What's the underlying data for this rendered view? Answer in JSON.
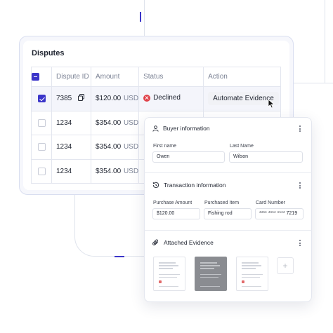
{
  "disputes": {
    "title": "Disputes",
    "columns": [
      "Dispute ID",
      "Amount",
      "Status",
      "Action"
    ],
    "rows": [
      {
        "id": "7385",
        "amount": "$120.00",
        "currency": "USD",
        "status": "Declined",
        "action": "Automate Evidence",
        "selected": true
      },
      {
        "id": "1234",
        "amount": "$354.00",
        "currency": "USD",
        "selected": false
      },
      {
        "id": "1234",
        "amount": "$354.00",
        "currency": "USD",
        "selected": false
      },
      {
        "id": "1234",
        "amount": "$354.00",
        "currency": "USD",
        "selected": false
      }
    ]
  },
  "evidence_card": {
    "buyer": {
      "title": "Buyer information",
      "first_name_label": "First name",
      "first_name_value": "Owen",
      "last_name_label": "Last Name",
      "last_name_value": "Wilson"
    },
    "transaction": {
      "title": "Transaction information",
      "amount_label": "Purchase Amount",
      "amount_value": "$120.00",
      "item_label": "Purchased Item",
      "item_value": "Fishing rod",
      "card_label": "Card Number",
      "card_value": "**** **** **** 7219"
    },
    "attachments": {
      "title": "Attached Evidence",
      "add_label": "+"
    }
  },
  "colors": {
    "accent": "#3b35c9",
    "declined": "#e0424a"
  }
}
